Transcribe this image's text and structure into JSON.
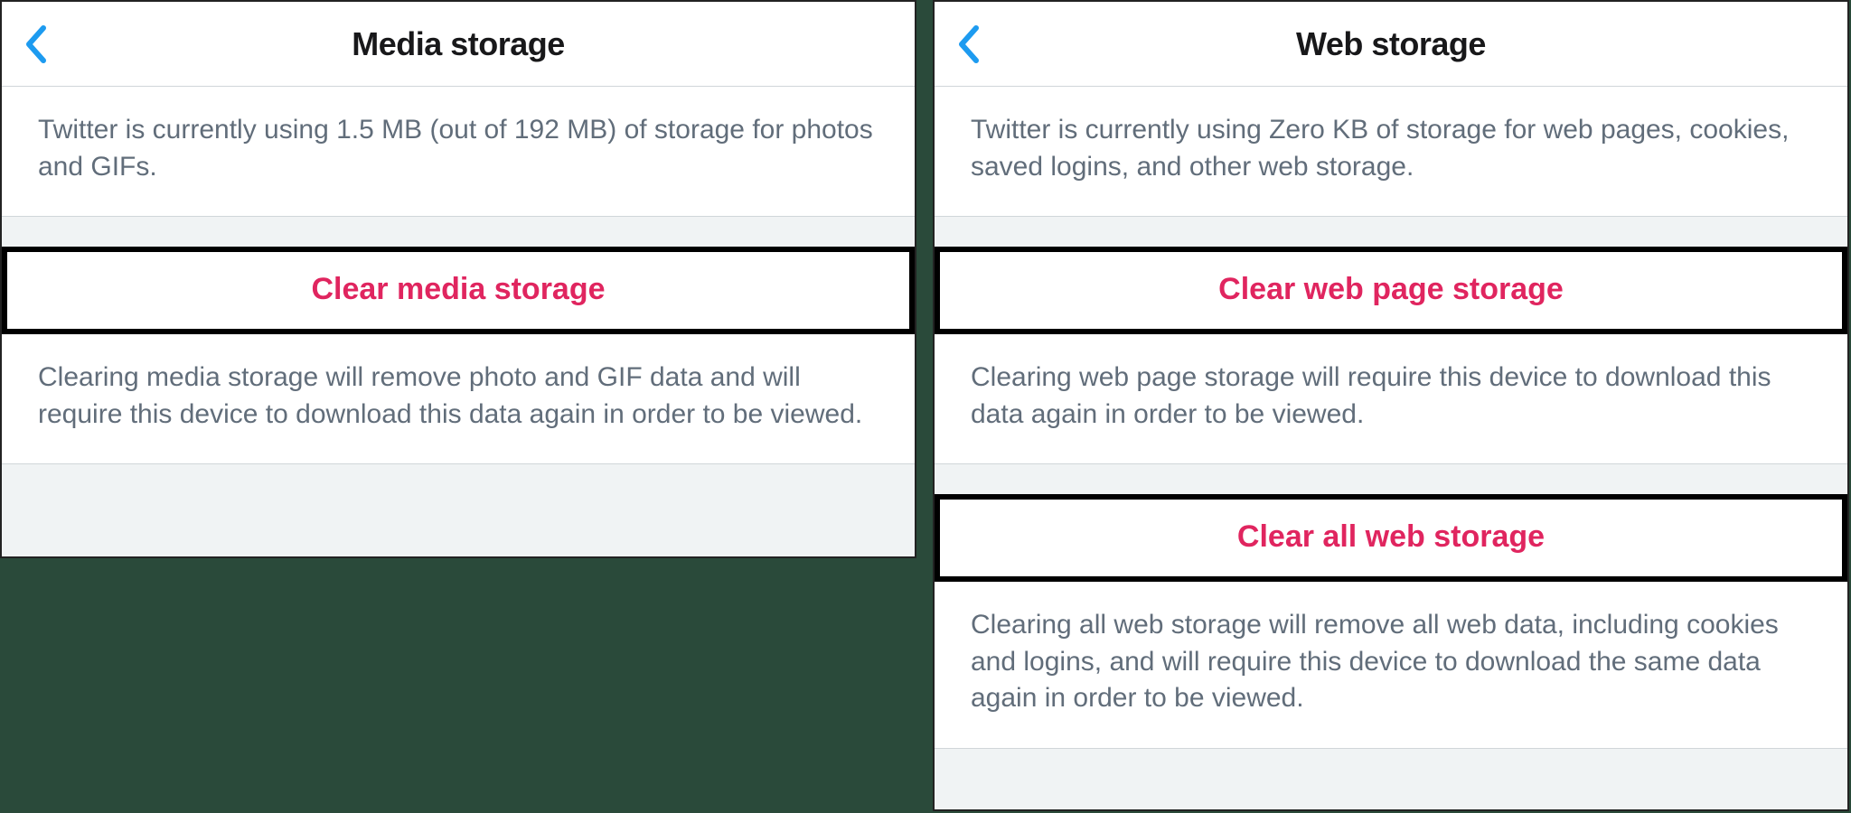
{
  "left": {
    "title": "Media storage",
    "info": "Twitter is currently using 1.5 MB (out of 192 MB) of storage for photos and GIFs.",
    "action1": "Clear media storage",
    "desc1": "Clearing media storage will remove photo and GIF data and will require this device to download this data again in order to be viewed."
  },
  "right": {
    "title": "Web storage",
    "info": "Twitter is currently using Zero KB of storage for web pages, cookies, saved logins, and other web storage.",
    "action1": "Clear web page storage",
    "desc1": "Clearing web page storage will require this device to download this data again in order to be viewed.",
    "action2": "Clear all web storage",
    "desc2": "Clearing all web storage will remove all web data, including cookies and logins, and will require this device to download the same data again in order to be viewed."
  }
}
